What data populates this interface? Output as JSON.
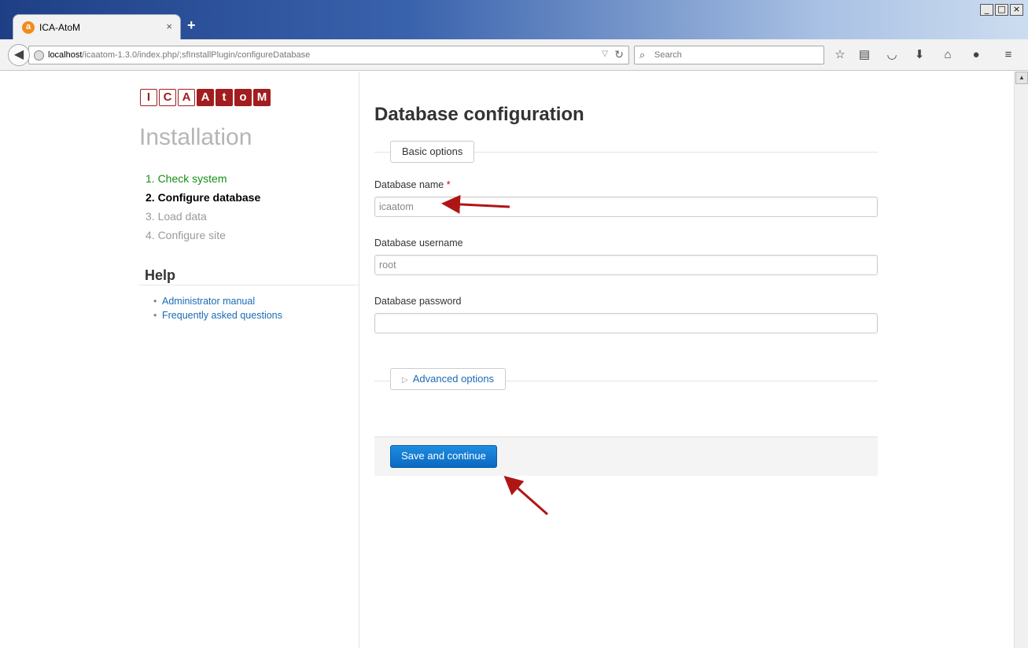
{
  "browser": {
    "tab_title": "ICA-AtoM",
    "tab_favicon_glyph": "a",
    "tab_close": "×",
    "new_tab": "+",
    "url_host": "localhost",
    "url_path": "/icaatom-1.3.0/index.php/;sfInstallPlugin/configureDatabase",
    "search_placeholder": "Search",
    "window_controls": [
      "_",
      "□",
      "×"
    ],
    "toolbar_icons": [
      "star-icon",
      "reading-list-icon",
      "pocket-icon",
      "download-icon",
      "home-icon",
      "chat-icon",
      "menu-icon"
    ]
  },
  "logo": {
    "letters": [
      {
        "ch": "I",
        "style": "outline"
      },
      {
        "ch": "C",
        "style": "outline"
      },
      {
        "ch": "A",
        "style": "outline"
      },
      {
        "ch": "A",
        "style": "filled"
      },
      {
        "ch": "t",
        "style": "filled"
      },
      {
        "ch": "o",
        "style": "filled"
      },
      {
        "ch": "M",
        "style": "filled"
      }
    ],
    "brand_color": "#a21d1f"
  },
  "sidebar": {
    "title": "Installation",
    "steps": [
      {
        "label": "1. Check system",
        "state": "done"
      },
      {
        "label": "2. Configure database",
        "state": "active"
      },
      {
        "label": "3. Load data",
        "state": "todo"
      },
      {
        "label": "4. Configure site",
        "state": "todo"
      }
    ],
    "help_title": "Help",
    "help_links": [
      "Administrator manual",
      "Frequently asked questions"
    ]
  },
  "main": {
    "title": "Database configuration",
    "basic_options": "Basic options",
    "fields": {
      "db_name": {
        "label": "Database name",
        "required_mark": "*",
        "value": "icaatom"
      },
      "db_username": {
        "label": "Database username",
        "value": "root"
      },
      "db_password": {
        "label": "Database password",
        "value": ""
      }
    },
    "advanced_glyph": "▷",
    "advanced_options": "Advanced options",
    "submit": "Save and continue"
  },
  "colors": {
    "link": "#1a6bb5",
    "step_done": "#148f14",
    "button": "#0a68c2",
    "arrow": "#b01515"
  }
}
